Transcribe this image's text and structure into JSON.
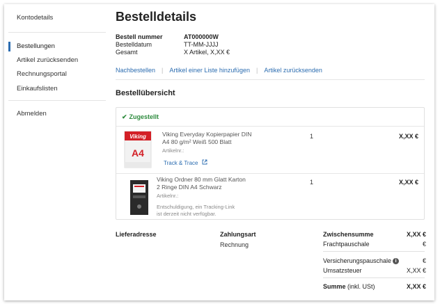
{
  "sidebar": {
    "items": [
      {
        "label": "Kontodetails"
      },
      {
        "label": "Bestellungen"
      },
      {
        "label": "Artikel zurücksenden"
      },
      {
        "label": "Rechnungsportal"
      },
      {
        "label": "Einkaufslisten"
      },
      {
        "label": "Abmelden"
      }
    ]
  },
  "page": {
    "title": "Bestelldetails",
    "order_number_label": "Bestell nummer",
    "order_number_value": "AT000000W",
    "order_date_label": "Bestelldatum",
    "order_date_value": "TT-MM-JJJJ",
    "total_label": "Gesamt",
    "total_value": "X Artikel, X,XX €"
  },
  "actions": {
    "reorder": "Nachbestellen",
    "add_to_list": "Artikel einer Liste hinzufügen",
    "return": "Artikel zurücksenden"
  },
  "overview": {
    "title": "Bestellübersicht",
    "status": "Zugestellt",
    "products": [
      {
        "name": "Viking Everyday Kopierpapier DIN A4 80 g/m² Weiß 500 Blatt",
        "article": "Artikelnr.:",
        "track": "Track & Trace",
        "qty": "1",
        "price": "X,XX €"
      },
      {
        "name": "Viking Ordner 80 mm Glatt Karton 2 Ringe DIN A4 Schwarz",
        "article": "Artikelnr.:",
        "note": "Entschuldigung, ein Tracking-Link ist derzeit nicht verfügbar.",
        "qty": "1",
        "price": "X,XX €"
      }
    ]
  },
  "summary": {
    "delivery_label": "Lieferadresse",
    "payment_label": "Zahlungsart",
    "payment_value": "Rechnung",
    "subtotal_label": "Zwischensumme",
    "subtotal_value": "X,XX €",
    "shipping_label": "Frachtpauschale",
    "shipping_value": "€",
    "insurance_label": "Versicherungspauschale",
    "insurance_value": "€",
    "tax_label": "Umsatzsteuer",
    "tax_value": "X,XX €",
    "sum_label_bold": "Summe",
    "sum_label_suffix": "(inkl. USt)",
    "sum_value": "X,XX €"
  },
  "colors": {
    "link": "#2b6cb0",
    "status_green": "#2e8b3e",
    "viking_red": "#d32027"
  }
}
